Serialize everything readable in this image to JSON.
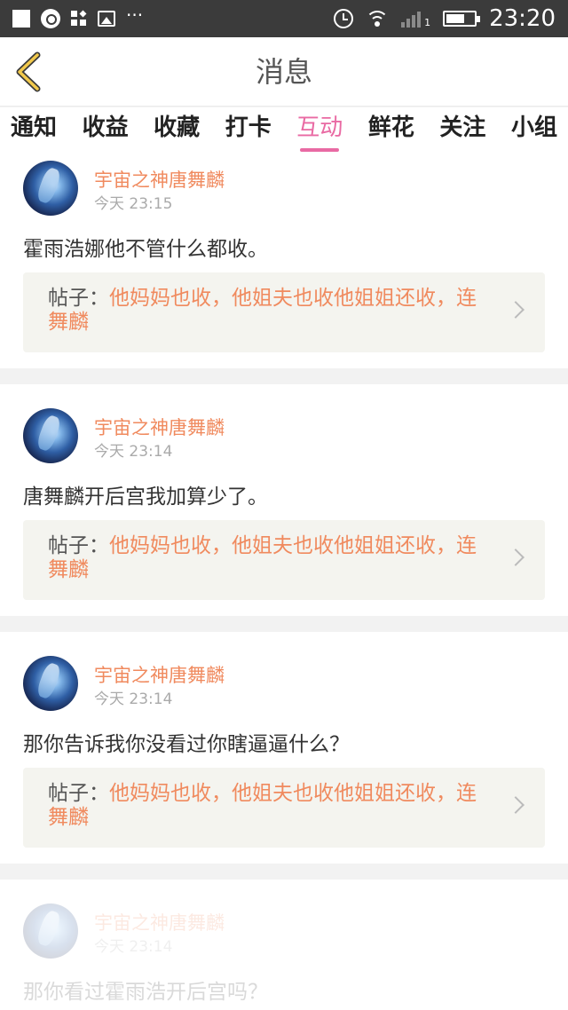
{
  "status_bar": {
    "time": "23:20",
    "dots": "···",
    "signal_label": "1"
  },
  "header": {
    "title": "消息"
  },
  "tabs": [
    {
      "label": "通知"
    },
    {
      "label": "收益"
    },
    {
      "label": "收藏"
    },
    {
      "label": "打卡"
    },
    {
      "label": "互动",
      "active": true
    },
    {
      "label": "鲜花"
    },
    {
      "label": "关注"
    },
    {
      "label": "小组"
    }
  ],
  "messages": [
    {
      "user": "宇宙之神唐舞麟",
      "time": "今天 23:15",
      "content": "霍雨浩娜他不管什么都收。",
      "quote_label": "帖子：",
      "quote_text": "他妈妈也收，他姐夫也收他姐姐还收，连舞麟"
    },
    {
      "user": "宇宙之神唐舞麟",
      "time": "今天 23:14",
      "content": "唐舞麟开后宫我加算少了。",
      "quote_label": "帖子：",
      "quote_text": "他妈妈也收，他姐夫也收他姐姐还收，连舞麟"
    },
    {
      "user": "宇宙之神唐舞麟",
      "time": "今天 23:14",
      "content": "那你告诉我你没看过你瞎逼逼什么？",
      "quote_label": "帖子：",
      "quote_text": "他妈妈也收，他姐夫也收他姐姐还收，连舞麟"
    },
    {
      "user": "宇宙之神唐舞麟",
      "time": "今天 23:14",
      "content": "那你看过霍雨浩开后宫吗？"
    }
  ],
  "colors": {
    "accent_pink": "#e96aa3",
    "username_orange": "#f08a5e",
    "status_bar": "#3b3b3b"
  }
}
